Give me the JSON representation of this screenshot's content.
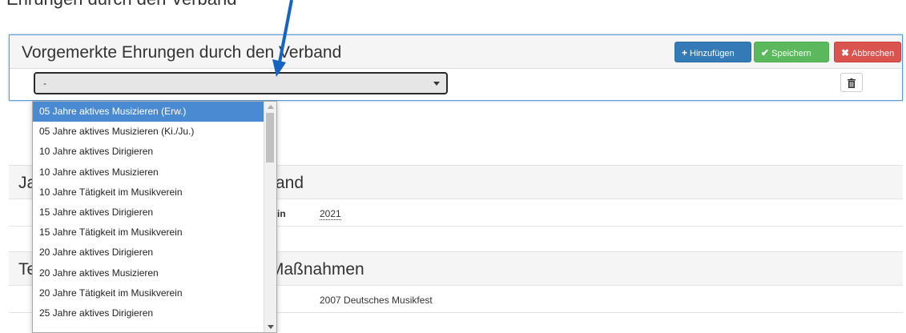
{
  "page": {
    "top_cut_text": "Ehrungen durch den Verband"
  },
  "panel": {
    "title": "Vorgemerkte Ehrungen durch den Verband",
    "buttons": {
      "add": "Hinzufügen",
      "save": "Speichern",
      "cancel": "Abbrechen"
    },
    "select_value": "-"
  },
  "dropdown": {
    "options": [
      "05 Jahre aktives Musizieren (Erw.)",
      "05 Jahre aktives Musizieren (Ki./Ju.)",
      "10 Jahre aktives Dirigieren",
      "10 Jahre aktives Musizieren",
      "10 Jahre Tätigkeit im Musikverein",
      "15 Jahre aktives Dirigieren",
      "15 Jahre Tätigkeit im Musikverein",
      "20 Jahre aktives Dirigieren",
      "20 Jahre aktives Musizieren",
      "20 Jahre Tätigkeit im Musikverein",
      "25 Jahre aktives Dirigieren"
    ],
    "selected_index": 0
  },
  "section1": {
    "title_left": "Ja",
    "title_right": "and",
    "row_label_tail": "et in",
    "row_value": "2021"
  },
  "section2": {
    "title_left": "Te",
    "title_right": "/Maßnahmen",
    "row_value": "2007 Deutsches Musikfest"
  },
  "colors": {
    "accent_blue": "#337ab7",
    "save_green": "#5cb85c",
    "cancel_red": "#d9534f",
    "selected_option": "#4a8ad2",
    "annotation_arrow": "#1565c0"
  }
}
